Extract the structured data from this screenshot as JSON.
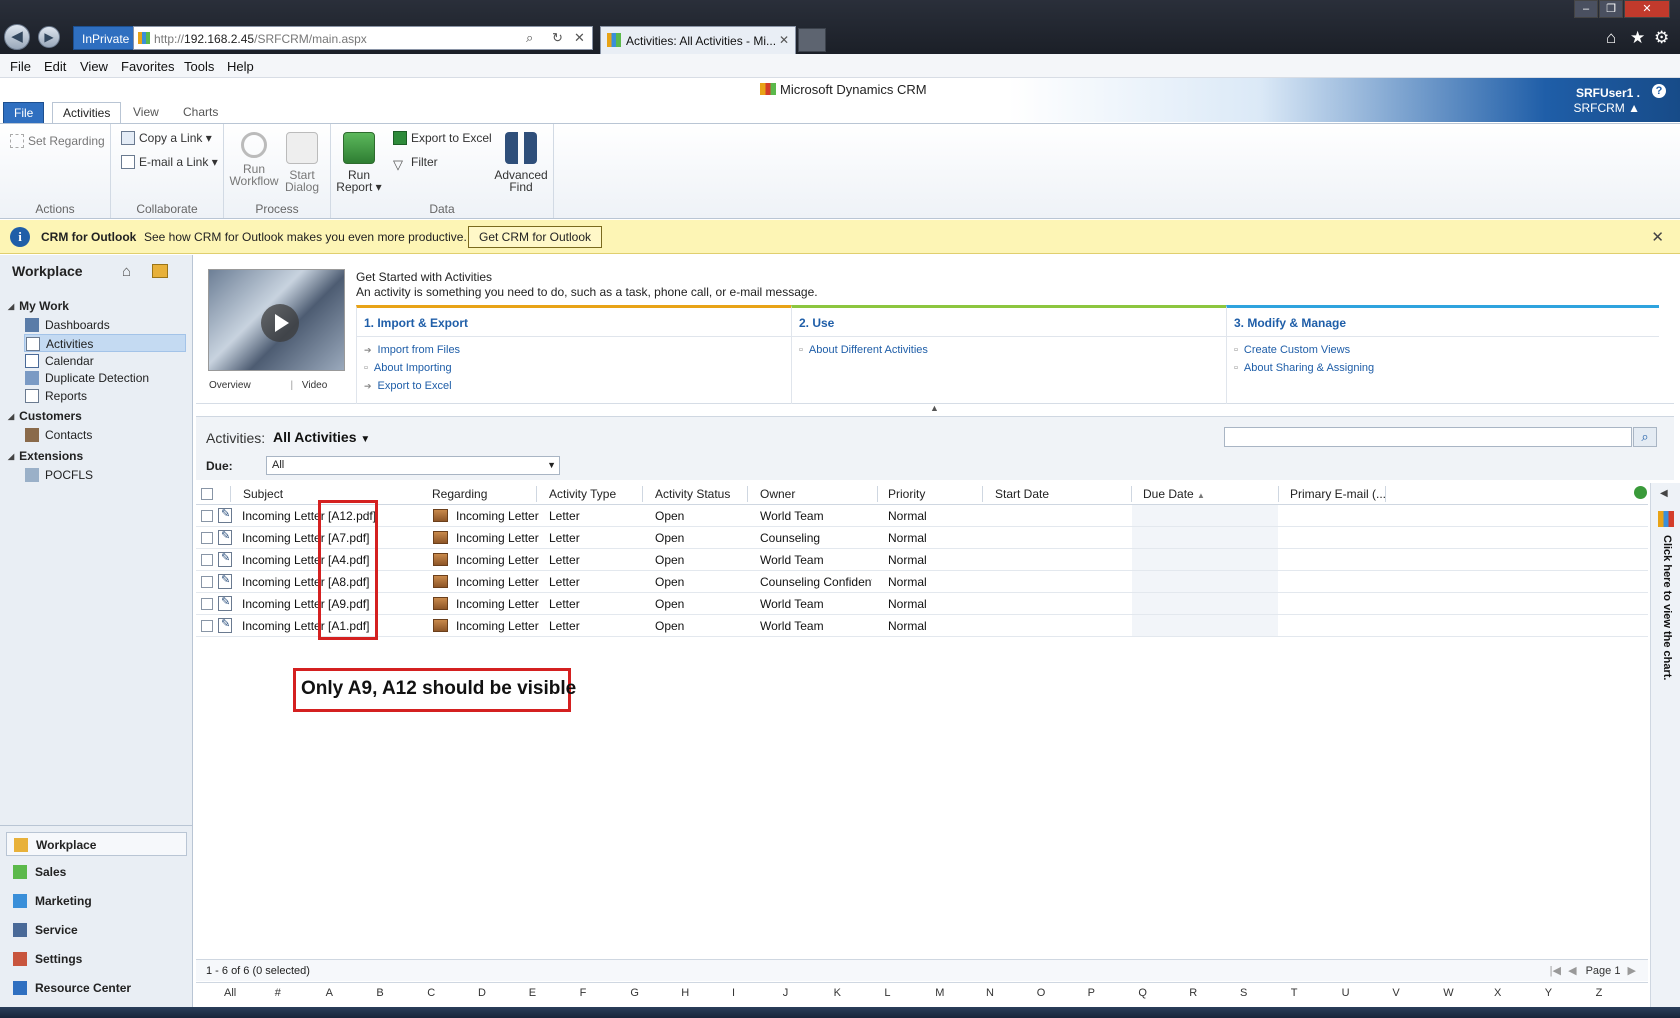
{
  "browser": {
    "inprivate": "InPrivate",
    "url_prefix": "http://",
    "url_host": "192.168.2.45",
    "url_path": "/SRFCRM/main.aspx",
    "tab_title": "Activities: All Activities - Mi..."
  },
  "menu": [
    "File",
    "Edit",
    "View",
    "Favorites",
    "Tools",
    "Help"
  ],
  "crm": {
    "brand": "Microsoft Dynamics CRM",
    "user_name": "SRFUser1 .",
    "org_name": "SRFCRM"
  },
  "ribbon_tabs": [
    "File",
    "Activities",
    "View",
    "Charts"
  ],
  "ribbon": {
    "set_regarding": "Set Regarding",
    "copy_link": "Copy a Link",
    "email_link": "E-mail a Link",
    "run_workflow_1": "Run",
    "run_workflow_2": "Workflow",
    "start_dialog_1": "Start",
    "start_dialog_2": "Dialog",
    "run_report_1": "Run",
    "run_report_2": "Report",
    "export_excel": "Export to Excel",
    "filter": "Filter",
    "advanced_find_1": "Advanced",
    "advanced_find_2": "Find",
    "groups": {
      "actions": "Actions",
      "collaborate": "Collaborate",
      "process": "Process",
      "data": "Data"
    }
  },
  "notification": {
    "title": "CRM for Outlook",
    "text": "See how CRM for Outlook makes you even more productive.",
    "button": "Get CRM for Outlook"
  },
  "leftnav": {
    "title": "Workplace",
    "groups": [
      {
        "label": "My Work",
        "items": [
          "Dashboards",
          "Activities",
          "Calendar",
          "Duplicate Detection",
          "Reports"
        ]
      },
      {
        "label": "Customers",
        "items": [
          "Contacts"
        ]
      },
      {
        "label": "Extensions",
        "items": [
          "POCFLS"
        ]
      }
    ],
    "areas": [
      "Workplace",
      "Sales",
      "Marketing",
      "Service",
      "Settings",
      "Resource Center"
    ]
  },
  "get_started": {
    "title": "Get Started with Activities",
    "subtitle": "An activity is something you need to do, such as a task, phone call, or e-mail message.",
    "overview": "Overview",
    "video": "Video",
    "sections": [
      {
        "heading": "1. Import & Export",
        "links": [
          "Import from Files",
          "About Importing",
          "Export to Excel"
        ],
        "color": "#e8a317"
      },
      {
        "heading": "2. Use",
        "links": [
          "About Different Activities"
        ],
        "color": "#8cc63f"
      },
      {
        "heading": "3. Modify & Manage",
        "links": [
          "Create Custom Views",
          "About Sharing & Assigning"
        ],
        "color": "#2ea3de"
      }
    ]
  },
  "view": {
    "label": "Activities:",
    "name": "All Activities",
    "due_label": "Due:",
    "due_value": "All"
  },
  "grid": {
    "columns": [
      "Subject",
      "Regarding",
      "Activity Type",
      "Activity Status",
      "Owner",
      "Priority",
      "Start Date",
      "Due Date",
      "Primary E-mail (..."
    ],
    "rows": [
      {
        "subject": "Incoming Letter [A12.pdf]",
        "regarding": "Incoming Letter",
        "type": "Letter",
        "status": "Open",
        "owner": "World Team",
        "priority": "Normal"
      },
      {
        "subject": "Incoming Letter [A7.pdf]",
        "regarding": "Incoming Letter",
        "type": "Letter",
        "status": "Open",
        "owner": "Counseling",
        "priority": "Normal"
      },
      {
        "subject": "Incoming Letter [A4.pdf]",
        "regarding": "Incoming Letter",
        "type": "Letter",
        "status": "Open",
        "owner": "World Team",
        "priority": "Normal"
      },
      {
        "subject": "Incoming Letter [A8.pdf]",
        "regarding": "Incoming Letter",
        "type": "Letter",
        "status": "Open",
        "owner": "Counseling Confidenti",
        "priority": "Normal"
      },
      {
        "subject": "Incoming Letter [A9.pdf]",
        "regarding": "Incoming Letter",
        "type": "Letter",
        "status": "Open",
        "owner": "World Team",
        "priority": "Normal"
      },
      {
        "subject": "Incoming Letter [A1.pdf]",
        "regarding": "Incoming Letter",
        "type": "Letter",
        "status": "Open",
        "owner": "World Team",
        "priority": "Normal"
      }
    ],
    "record_count": "1 - 6 of 6 (0 selected)",
    "page": "Page 1",
    "chart_hint": "Click here to view the chart."
  },
  "annotation": "Only A9, A12 should be visible",
  "alphabet": [
    "All",
    "#",
    "A",
    "B",
    "C",
    "D",
    "E",
    "F",
    "G",
    "H",
    "I",
    "J",
    "K",
    "L",
    "M",
    "N",
    "O",
    "P",
    "Q",
    "R",
    "S",
    "T",
    "U",
    "V",
    "W",
    "X",
    "Y",
    "Z"
  ]
}
